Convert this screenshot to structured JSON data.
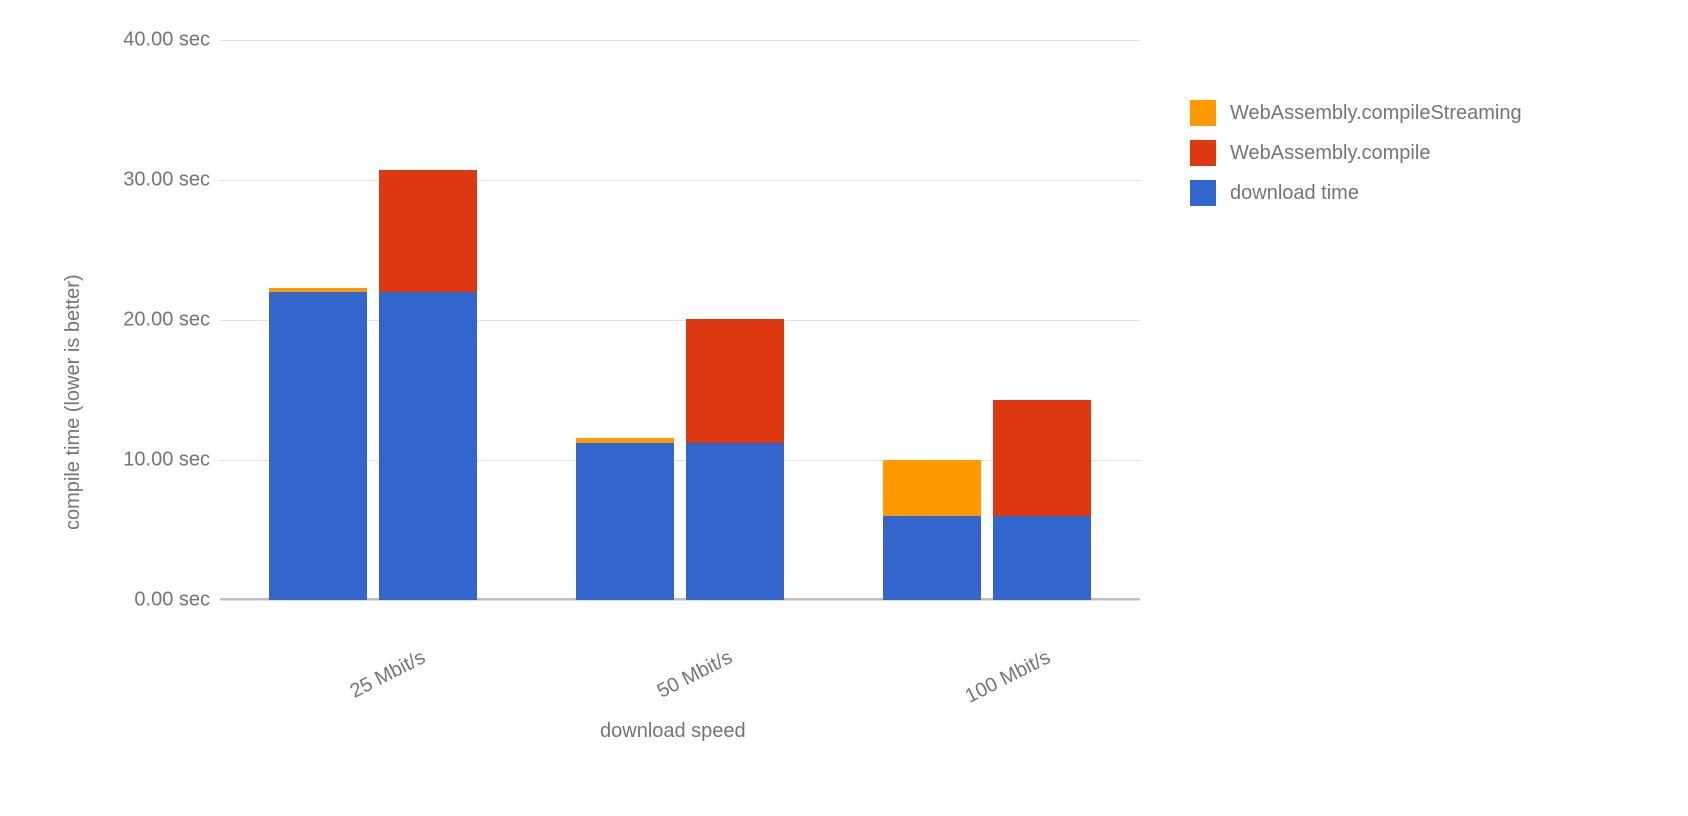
{
  "chart_data": {
    "type": "bar",
    "stacked": true,
    "grouped": true,
    "categories": [
      "25 Mbit/s",
      "50 Mbit/s",
      "100 Mbit/s"
    ],
    "series": [
      {
        "name": "download time",
        "color": "#3366cc"
      },
      {
        "name": "WebAssembly.compile",
        "color": "#dc3912"
      },
      {
        "name": "WebAssembly.compileStreaming",
        "color": "#ff9900"
      }
    ],
    "bars": [
      {
        "category": "25 Mbit/s",
        "subgroup": 0,
        "stack": {
          "download time": 22.0,
          "WebAssembly.compileStreaming": 0.3
        }
      },
      {
        "category": "25 Mbit/s",
        "subgroup": 1,
        "stack": {
          "download time": 22.0,
          "WebAssembly.compile": 8.7
        }
      },
      {
        "category": "50 Mbit/s",
        "subgroup": 0,
        "stack": {
          "download time": 11.2,
          "WebAssembly.compileStreaming": 0.4
        }
      },
      {
        "category": "50 Mbit/s",
        "subgroup": 1,
        "stack": {
          "download time": 11.2,
          "WebAssembly.compile": 8.9
        }
      },
      {
        "category": "100 Mbit/s",
        "subgroup": 0,
        "stack": {
          "download time": 6.0,
          "WebAssembly.compileStreaming": 4.0
        }
      },
      {
        "category": "100 Mbit/s",
        "subgroup": 1,
        "stack": {
          "download time": 6.0,
          "WebAssembly.compile": 8.3
        }
      }
    ],
    "xlabel": "download speed",
    "ylabel": "compile time (lower is better)",
    "ylim": [
      0,
      40
    ],
    "y_ticks": [
      {
        "value": 0,
        "label": "0.00 sec"
      },
      {
        "value": 10,
        "label": "10.00 sec"
      },
      {
        "value": 20,
        "label": "20.00 sec"
      },
      {
        "value": 30,
        "label": "30.00 sec"
      },
      {
        "value": 40,
        "label": "40.00 sec"
      }
    ],
    "legend_order": [
      "WebAssembly.compileStreaming",
      "WebAssembly.compile",
      "download time"
    ]
  }
}
